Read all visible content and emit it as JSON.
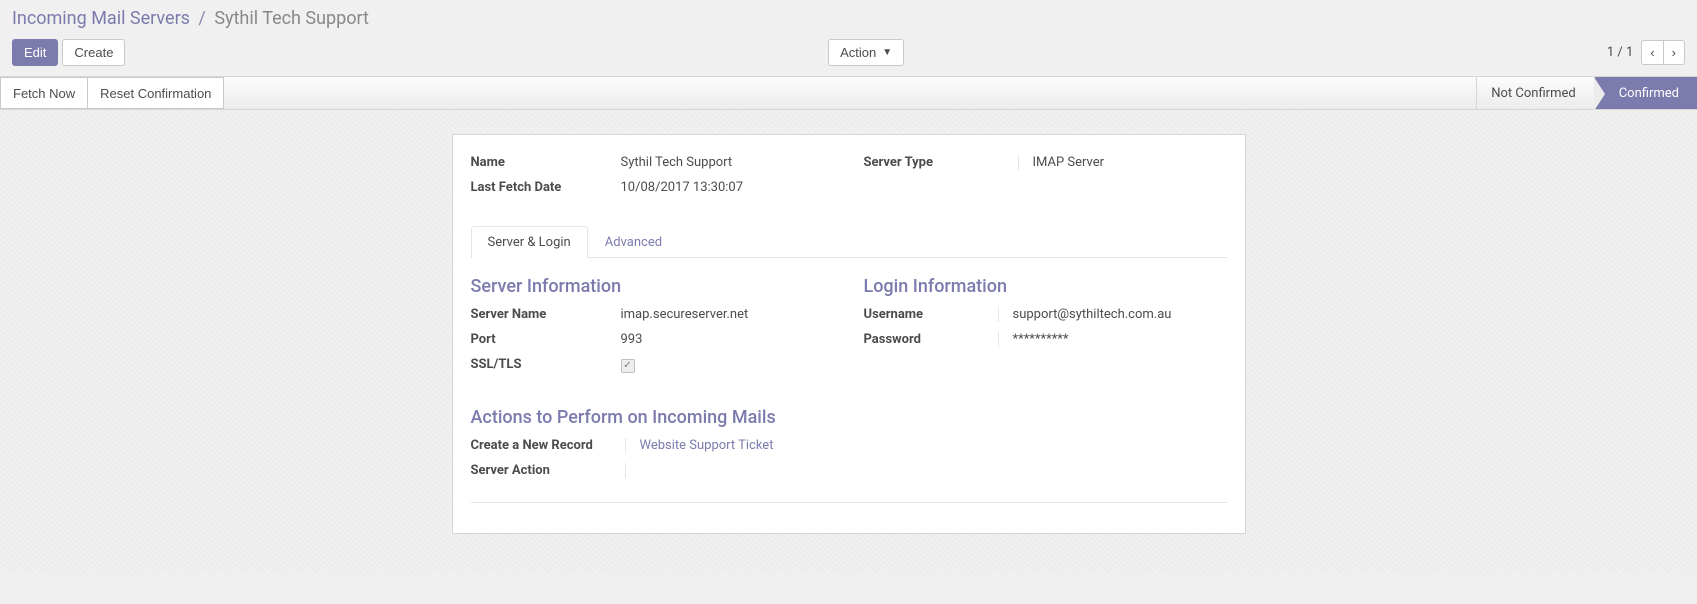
{
  "breadcrumb": {
    "parent": "Incoming Mail Servers",
    "current": "Sythil Tech Support"
  },
  "buttons": {
    "edit": "Edit",
    "create": "Create",
    "action": "Action",
    "fetch_now": "Fetch Now",
    "reset_confirmation": "Reset Confirmation"
  },
  "pager": {
    "text": "1 / 1",
    "prev": "‹",
    "next": "›"
  },
  "status": {
    "not_confirmed": "Not Confirmed",
    "confirmed": "Confirmed"
  },
  "fields": {
    "name_label": "Name",
    "name_value": "Sythil Tech Support",
    "last_fetch_label": "Last Fetch Date",
    "last_fetch_value": "10/08/2017 13:30:07",
    "server_type_label": "Server Type",
    "server_type_value": "IMAP Server"
  },
  "tabs": {
    "server_login": "Server & Login",
    "advanced": "Advanced"
  },
  "server_info": {
    "heading": "Server Information",
    "server_name_label": "Server Name",
    "server_name_value": "imap.secureserver.net",
    "port_label": "Port",
    "port_value": "993",
    "ssl_label": "SSL/TLS",
    "ssl_checked": "✓"
  },
  "login_info": {
    "heading": "Login Information",
    "username_label": "Username",
    "username_value": "support@sythiltech.com.au",
    "password_label": "Password",
    "password_value": "**********"
  },
  "actions_section": {
    "heading": "Actions to Perform on Incoming Mails",
    "create_record_label": "Create a New Record",
    "create_record_value": "Website Support Ticket",
    "server_action_label": "Server Action",
    "server_action_value": ""
  }
}
